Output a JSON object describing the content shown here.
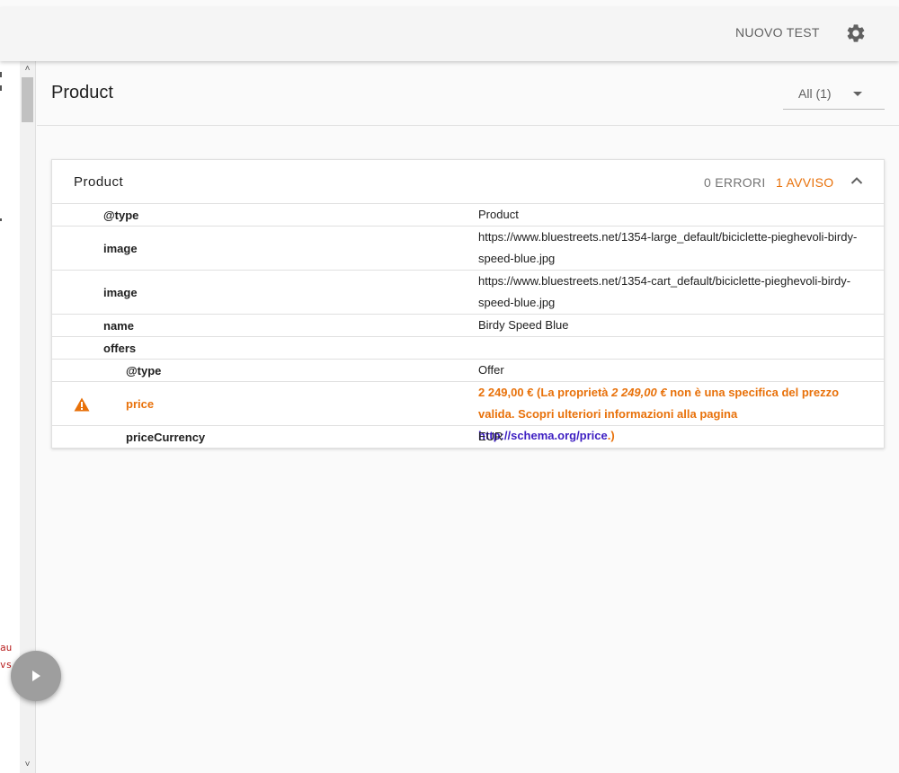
{
  "topbar": {
    "new_test_label": "NUOVO TEST",
    "settings_icon": "gear-icon"
  },
  "sidebar": {
    "code_fragments": [
      "au",
      "vs"
    ],
    "play_icon": "play-icon"
  },
  "header": {
    "title": "Product",
    "filter_value": "All (1)"
  },
  "card": {
    "title": "Product",
    "errors_label": "0 ERRORI",
    "warnings_label": "1 AVVISO",
    "rows": [
      {
        "prop": "@type",
        "value": "Product"
      },
      {
        "prop": "image",
        "value": "https://www.bluestreets.net/1354-large_default/biciclette-pieghevoli-birdy-speed-blue.jpg"
      },
      {
        "prop": "image",
        "value": "https://www.bluestreets.net/1354-cart_default/biciclette-pieghevoli-birdy-speed-blue.jpg"
      },
      {
        "prop": "name",
        "value": "Birdy Speed Blue"
      },
      {
        "prop": "offers",
        "value": ""
      },
      {
        "prop": "@type",
        "value": "Offer"
      },
      {
        "prop": "price",
        "value_part1": "2 249,00 € (La proprietà ",
        "value_em": "2 249,00 €",
        "value_part2": " non è una specifica del prezzo valida. Scopri ulteriori informazioni alla pagina ",
        "value_link": "http://schema.org/price",
        "value_part3": ".)"
      },
      {
        "prop": "priceCurrency",
        "value": "EUR"
      }
    ]
  },
  "colors": {
    "warning": "#e8710a",
    "link": "#3d1fc2",
    "divider": "#e0e0e0"
  }
}
